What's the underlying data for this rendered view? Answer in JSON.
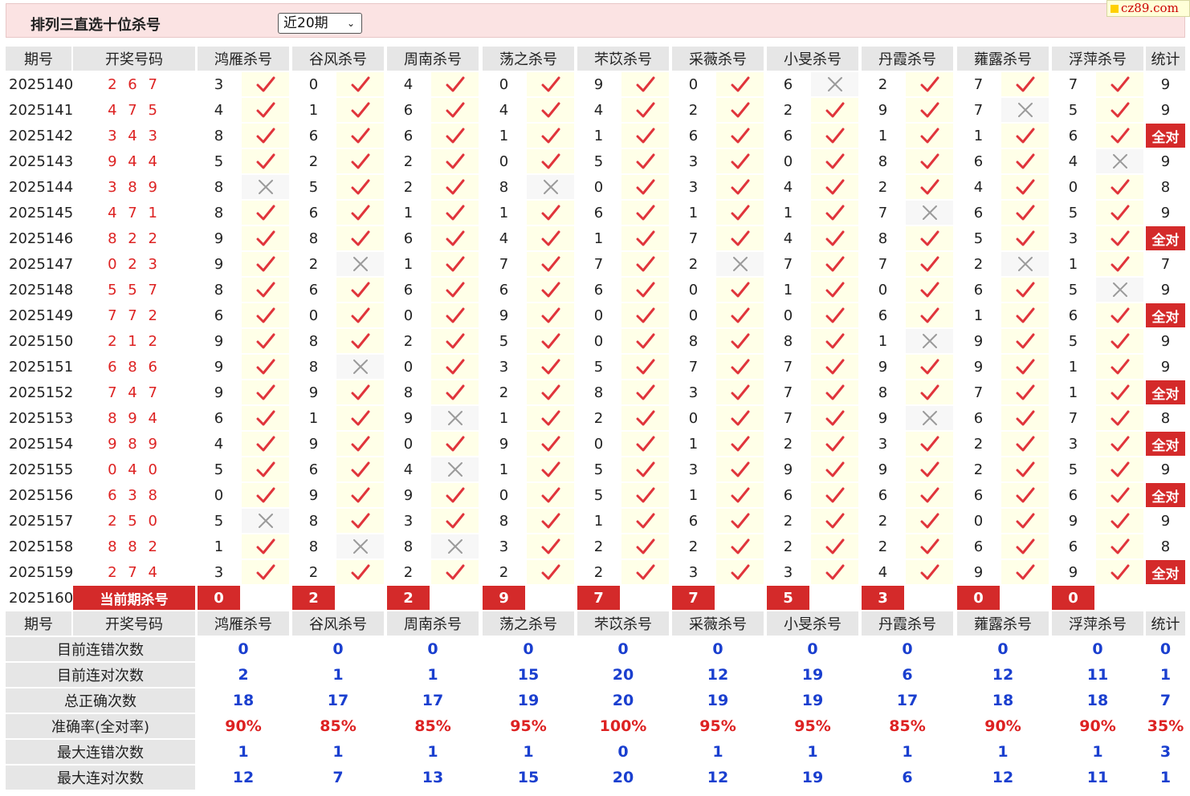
{
  "header": {
    "title": "排列三直选十位杀号",
    "period_selected": "近20期",
    "logo_text": "cz89.com"
  },
  "columns": {
    "issue": "期号",
    "draw": "开奖号码",
    "experts": [
      "鸿雁杀号",
      "谷风杀号",
      "周南杀号",
      "荡之杀号",
      "芣苡杀号",
      "采薇杀号",
      "小旻杀号",
      "丹霞杀号",
      "蕹露杀号",
      "浮萍杀号"
    ],
    "stat": "统计"
  },
  "rows": [
    {
      "issue": "2025140",
      "draw": "2 6 7",
      "kills": [
        3,
        0,
        4,
        0,
        9,
        0,
        6,
        2,
        7,
        7
      ],
      "hits": [
        1,
        1,
        1,
        1,
        1,
        1,
        0,
        1,
        1,
        1
      ],
      "stat": "9"
    },
    {
      "issue": "2025141",
      "draw": "4 7 5",
      "kills": [
        4,
        1,
        6,
        4,
        4,
        2,
        2,
        9,
        7,
        5
      ],
      "hits": [
        1,
        1,
        1,
        1,
        1,
        1,
        1,
        1,
        0,
        1
      ],
      "stat": "9"
    },
    {
      "issue": "2025142",
      "draw": "3 4 3",
      "kills": [
        8,
        6,
        6,
        1,
        1,
        6,
        6,
        1,
        1,
        6
      ],
      "hits": [
        1,
        1,
        1,
        1,
        1,
        1,
        1,
        1,
        1,
        1
      ],
      "stat": "全对"
    },
    {
      "issue": "2025143",
      "draw": "9 4 4",
      "kills": [
        5,
        2,
        2,
        0,
        5,
        3,
        0,
        8,
        6,
        4
      ],
      "hits": [
        1,
        1,
        1,
        1,
        1,
        1,
        1,
        1,
        1,
        0
      ],
      "stat": "9"
    },
    {
      "issue": "2025144",
      "draw": "3 8 9",
      "kills": [
        8,
        5,
        2,
        8,
        0,
        3,
        4,
        2,
        4,
        0
      ],
      "hits": [
        0,
        1,
        1,
        0,
        1,
        1,
        1,
        1,
        1,
        1
      ],
      "stat": "8"
    },
    {
      "issue": "2025145",
      "draw": "4 7 1",
      "kills": [
        8,
        6,
        1,
        1,
        6,
        1,
        1,
        7,
        6,
        5
      ],
      "hits": [
        1,
        1,
        1,
        1,
        1,
        1,
        1,
        0,
        1,
        1
      ],
      "stat": "9"
    },
    {
      "issue": "2025146",
      "draw": "8 2 2",
      "kills": [
        9,
        8,
        6,
        4,
        1,
        7,
        4,
        8,
        5,
        3
      ],
      "hits": [
        1,
        1,
        1,
        1,
        1,
        1,
        1,
        1,
        1,
        1
      ],
      "stat": "全对"
    },
    {
      "issue": "2025147",
      "draw": "0 2 3",
      "kills": [
        9,
        2,
        1,
        7,
        7,
        2,
        7,
        7,
        2,
        1
      ],
      "hits": [
        1,
        0,
        1,
        1,
        1,
        0,
        1,
        1,
        0,
        1
      ],
      "stat": "7"
    },
    {
      "issue": "2025148",
      "draw": "5 5 7",
      "kills": [
        8,
        6,
        6,
        6,
        6,
        0,
        1,
        0,
        6,
        5
      ],
      "hits": [
        1,
        1,
        1,
        1,
        1,
        1,
        1,
        1,
        1,
        0
      ],
      "stat": "9"
    },
    {
      "issue": "2025149",
      "draw": "7 7 2",
      "kills": [
        6,
        0,
        0,
        9,
        0,
        0,
        0,
        6,
        1,
        6
      ],
      "hits": [
        1,
        1,
        1,
        1,
        1,
        1,
        1,
        1,
        1,
        1
      ],
      "stat": "全对"
    },
    {
      "issue": "2025150",
      "draw": "2 1 2",
      "kills": [
        9,
        8,
        2,
        5,
        0,
        8,
        8,
        1,
        9,
        5
      ],
      "hits": [
        1,
        1,
        1,
        1,
        1,
        1,
        1,
        0,
        1,
        1
      ],
      "stat": "9"
    },
    {
      "issue": "2025151",
      "draw": "6 8 6",
      "kills": [
        9,
        8,
        0,
        3,
        5,
        7,
        7,
        9,
        9,
        1
      ],
      "hits": [
        1,
        0,
        1,
        1,
        1,
        1,
        1,
        1,
        1,
        1
      ],
      "stat": "9"
    },
    {
      "issue": "2025152",
      "draw": "7 4 7",
      "kills": [
        9,
        9,
        8,
        2,
        8,
        3,
        7,
        8,
        7,
        1
      ],
      "hits": [
        1,
        1,
        1,
        1,
        1,
        1,
        1,
        1,
        1,
        1
      ],
      "stat": "全对"
    },
    {
      "issue": "2025153",
      "draw": "8 9 4",
      "kills": [
        6,
        1,
        9,
        1,
        2,
        0,
        7,
        9,
        6,
        7
      ],
      "hits": [
        1,
        1,
        0,
        1,
        1,
        1,
        1,
        0,
        1,
        1
      ],
      "stat": "8"
    },
    {
      "issue": "2025154",
      "draw": "9 8 9",
      "kills": [
        4,
        9,
        0,
        9,
        0,
        1,
        2,
        3,
        2,
        3
      ],
      "hits": [
        1,
        1,
        1,
        1,
        1,
        1,
        1,
        1,
        1,
        1
      ],
      "stat": "全对"
    },
    {
      "issue": "2025155",
      "draw": "0 4 0",
      "kills": [
        5,
        6,
        4,
        1,
        5,
        3,
        9,
        9,
        2,
        5
      ],
      "hits": [
        1,
        1,
        0,
        1,
        1,
        1,
        1,
        1,
        1,
        1
      ],
      "stat": "9"
    },
    {
      "issue": "2025156",
      "draw": "6 3 8",
      "kills": [
        0,
        9,
        9,
        0,
        5,
        1,
        6,
        6,
        6,
        6
      ],
      "hits": [
        1,
        1,
        1,
        1,
        1,
        1,
        1,
        1,
        1,
        1
      ],
      "stat": "全对"
    },
    {
      "issue": "2025157",
      "draw": "2 5 0",
      "kills": [
        5,
        8,
        3,
        8,
        1,
        6,
        2,
        2,
        0,
        9
      ],
      "hits": [
        0,
        1,
        1,
        1,
        1,
        1,
        1,
        1,
        1,
        1
      ],
      "stat": "9"
    },
    {
      "issue": "2025158",
      "draw": "8 8 2",
      "kills": [
        1,
        8,
        8,
        3,
        2,
        2,
        2,
        2,
        6,
        6
      ],
      "hits": [
        1,
        0,
        0,
        1,
        1,
        1,
        1,
        1,
        1,
        1
      ],
      "stat": "8"
    },
    {
      "issue": "2025159",
      "draw": "2 7 4",
      "kills": [
        3,
        2,
        2,
        2,
        2,
        3,
        3,
        4,
        9,
        9
      ],
      "hits": [
        1,
        1,
        1,
        1,
        1,
        1,
        1,
        1,
        1,
        1
      ],
      "stat": "全对"
    }
  ],
  "current": {
    "issue": "2025160",
    "label": "当前期杀号",
    "kills": [
      0,
      2,
      2,
      9,
      7,
      7,
      5,
      3,
      0,
      0
    ]
  },
  "stats": [
    {
      "label": "目前连错次数",
      "values": [
        "0",
        "0",
        "0",
        "0",
        "0",
        "0",
        "0",
        "0",
        "0",
        "0"
      ],
      "total": "0",
      "pct": false
    },
    {
      "label": "目前连对次数",
      "values": [
        "2",
        "1",
        "1",
        "15",
        "20",
        "12",
        "19",
        "6",
        "12",
        "11"
      ],
      "total": "1",
      "pct": false
    },
    {
      "label": "总正确次数",
      "values": [
        "18",
        "17",
        "17",
        "19",
        "20",
        "19",
        "19",
        "17",
        "18",
        "18"
      ],
      "total": "7",
      "pct": false
    },
    {
      "label": "准确率(全对率)",
      "values": [
        "90%",
        "85%",
        "85%",
        "95%",
        "100%",
        "95%",
        "95%",
        "85%",
        "90%",
        "90%"
      ],
      "total": "35%",
      "pct": true
    },
    {
      "label": "最大连错次数",
      "values": [
        "1",
        "1",
        "1",
        "1",
        "0",
        "1",
        "1",
        "1",
        "1",
        "1"
      ],
      "total": "3",
      "pct": false
    },
    {
      "label": "最大连对次数",
      "values": [
        "12",
        "7",
        "13",
        "15",
        "20",
        "12",
        "19",
        "6",
        "12",
        "11"
      ],
      "total": "1",
      "pct": false
    }
  ],
  "colors": {
    "accent_red": "#d42a2a",
    "check_red": "#e0343b",
    "cross_gray": "#9a9a9a",
    "stat_blue": "#1a3fcf"
  }
}
